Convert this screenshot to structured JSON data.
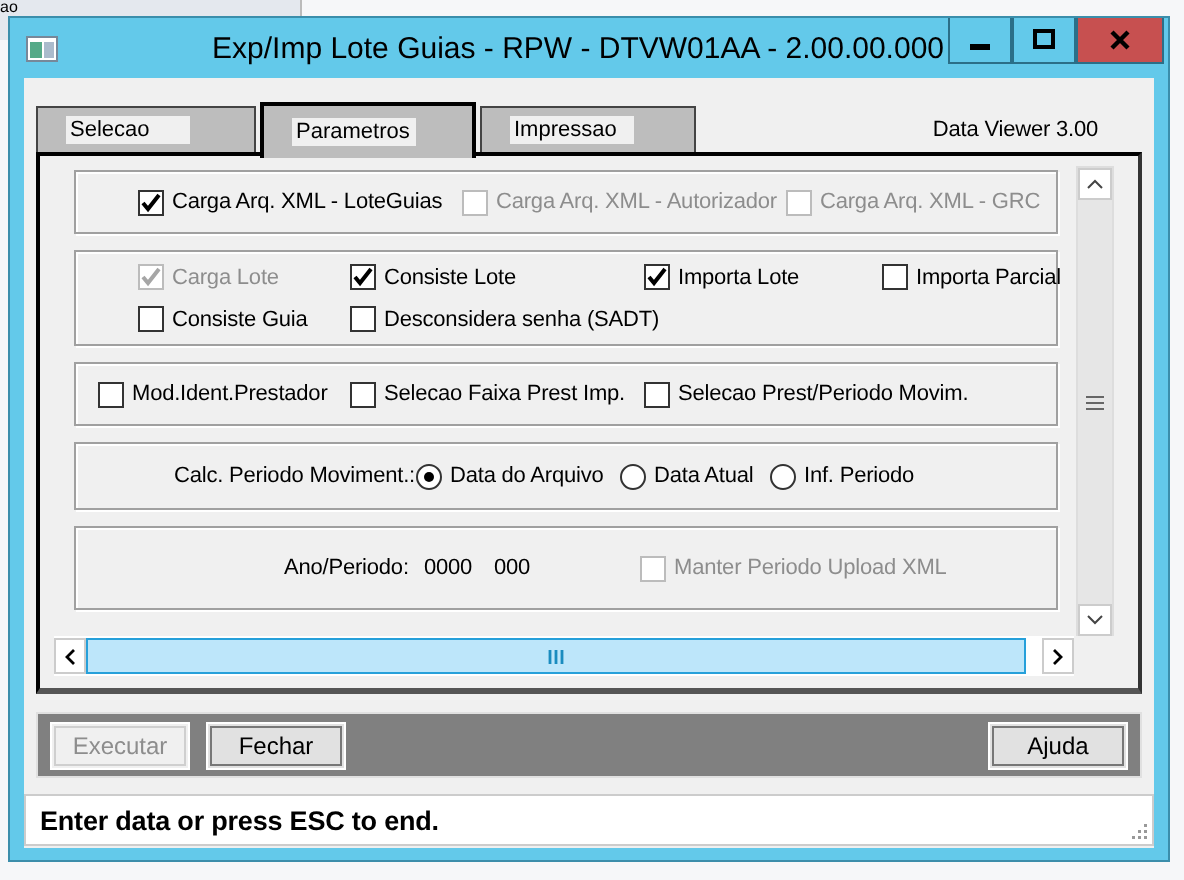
{
  "background_window": {
    "text": "ao"
  },
  "window": {
    "title": "Exp/Imp Lote Guias - RPW - DTVW01AA - 2.00.00.000"
  },
  "tabs": [
    {
      "label": "Selecao",
      "selected": false
    },
    {
      "label": "Parametros",
      "selected": true
    },
    {
      "label": "Impressao",
      "selected": false
    }
  ],
  "version": "Data Viewer 3.00",
  "groups": [
    {
      "rows": [
        [
          {
            "kind": "checkbox",
            "label": "Carga Arq. XML - LoteGuias",
            "checked": true,
            "disabled": false
          },
          {
            "kind": "checkbox",
            "label": "Carga Arq. XML - Autorizador",
            "checked": false,
            "disabled": true
          },
          {
            "kind": "checkbox",
            "label": "Carga Arq. XML - GRC",
            "checked": false,
            "disabled": true
          }
        ]
      ]
    },
    {
      "rows": [
        [
          {
            "kind": "checkbox",
            "label": "Carga Lote",
            "checked": true,
            "disabled": true
          },
          {
            "kind": "checkbox",
            "label": "Consiste Lote",
            "checked": true,
            "disabled": false
          },
          {
            "kind": "checkbox",
            "label": "Importa Lote",
            "checked": true,
            "disabled": false
          },
          {
            "kind": "checkbox",
            "label": "Importa Parcial",
            "checked": false,
            "disabled": false
          }
        ],
        [
          {
            "kind": "checkbox",
            "label": "Consiste Guia",
            "checked": false,
            "disabled": false
          },
          {
            "kind": "checkbox",
            "label": "Desconsidera senha (SADT)",
            "checked": false,
            "disabled": false
          }
        ]
      ]
    },
    {
      "rows": [
        [
          {
            "kind": "checkbox",
            "label": "Mod.Ident.Prestador",
            "checked": false,
            "disabled": false
          },
          {
            "kind": "checkbox",
            "label": "Selecao Faixa Prest Imp.",
            "checked": false,
            "disabled": false
          },
          {
            "kind": "checkbox",
            "label": "Selecao Prest/Periodo Movim.",
            "checked": false,
            "disabled": false
          }
        ]
      ]
    },
    {
      "rows": [
        [
          {
            "kind": "label",
            "text": "Calc. Periodo Moviment.:"
          },
          {
            "kind": "radio",
            "label": "Data do Arquivo",
            "selected": true
          },
          {
            "kind": "radio",
            "label": "Data Atual",
            "selected": false
          },
          {
            "kind": "radio",
            "label": "Inf. Periodo",
            "selected": false
          }
        ]
      ]
    },
    {
      "rows": [
        [
          {
            "kind": "label",
            "text": "Ano/Periodo:"
          },
          {
            "kind": "value",
            "text": "0000"
          },
          {
            "kind": "value",
            "text": "000"
          },
          {
            "kind": "checkbox",
            "label": "Manter Periodo Upload XML",
            "checked": false,
            "disabled": true
          }
        ]
      ]
    }
  ],
  "buttons": [
    {
      "label": "Executar",
      "disabled": true
    },
    {
      "label": "Fechar",
      "disabled": false
    },
    {
      "label": "Ajuda",
      "disabled": false
    }
  ],
  "status_bar": "Enter data or press ESC to end."
}
